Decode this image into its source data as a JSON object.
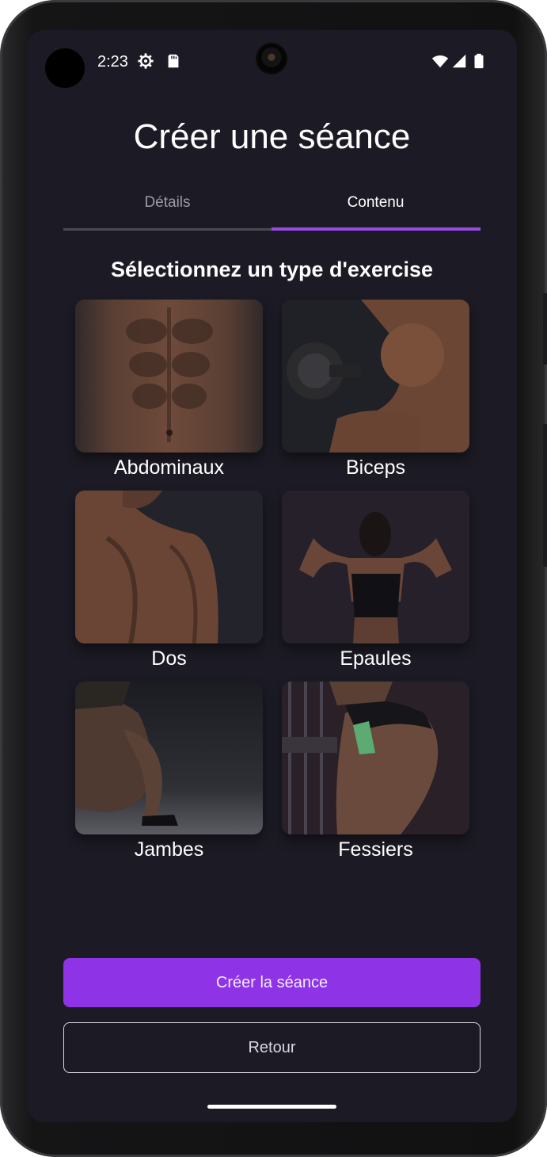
{
  "status_bar": {
    "time": "2:23",
    "icons": [
      "settings-icon",
      "sd-card-icon",
      "wifi-icon",
      "signal-icon",
      "battery-icon"
    ]
  },
  "header": {
    "title": "Créer une séance"
  },
  "tabs": [
    {
      "label": "Détails",
      "selected": false
    },
    {
      "label": "Contenu",
      "selected": true
    }
  ],
  "main": {
    "subtitle": "Sélectionnez un type d'exercise",
    "exercise_types": [
      {
        "label": "Abdominaux"
      },
      {
        "label": "Biceps"
      },
      {
        "label": "Dos"
      },
      {
        "label": "Epaules"
      },
      {
        "label": "Jambes"
      },
      {
        "label": "Fessiers"
      }
    ]
  },
  "actions": {
    "create_label": "Créer la séance",
    "back_label": "Retour"
  },
  "colors": {
    "background": "#1c1b25",
    "accent": "#8e34e6",
    "tab_indicator": "#9a4be6"
  }
}
